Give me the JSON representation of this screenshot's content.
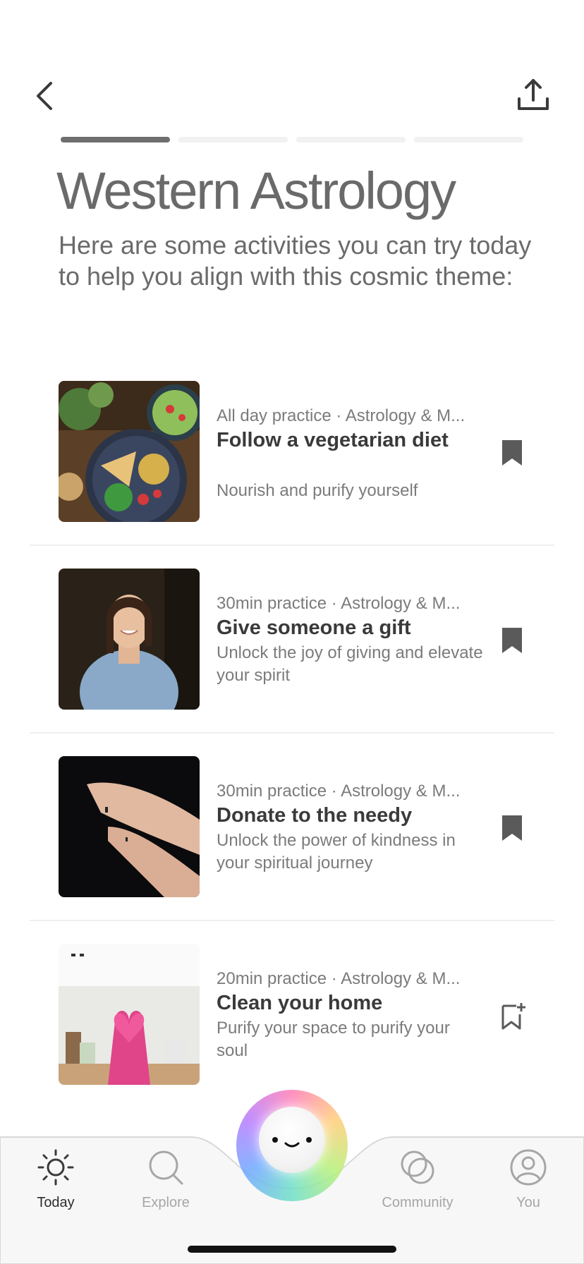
{
  "header": {
    "back_icon": "chevron-left-icon",
    "share_icon": "share-upload-icon",
    "progress": {
      "segments": 4,
      "active_index": 0
    }
  },
  "page": {
    "title": "Western Astrology",
    "intro": "Here are some activities you can try today to help you align with this cosmic theme:"
  },
  "activities": [
    {
      "meta": "All day practice · Astrology & M...",
      "name": "Follow a vegetarian diet",
      "description": "Nourish and purify yourself",
      "bookmarked": true,
      "image": "vegetarian-food-bowls"
    },
    {
      "meta": "30min practice · Astrology & M...",
      "name": "Give someone a gift",
      "description": "Unlock the joy of giving and elevate your spirit",
      "bookmarked": true,
      "image": "smiling-woman"
    },
    {
      "meta": "30min practice · Astrology & M...",
      "name": "Donate to the needy",
      "description": "Unlock the power of kindness in your spiritual journey",
      "bookmarked": true,
      "image": "hands-giving"
    },
    {
      "meta": "20min practice · Astrology & M...",
      "name": "Clean your home",
      "description": "Purify your space to purify your soul",
      "bookmarked": false,
      "image": "pink-gloves-heart-kitchen"
    }
  ],
  "tabbar": {
    "tabs": [
      {
        "label": "Today",
        "icon": "sun-icon",
        "active": true
      },
      {
        "label": "Explore",
        "icon": "search-icon",
        "active": false
      },
      {
        "label": "Community",
        "icon": "community-icon",
        "active": false
      },
      {
        "label": "You",
        "icon": "profile-icon",
        "active": false
      }
    ],
    "center_button_icon": "smiley-orb-icon"
  },
  "colors": {
    "text_dark": "#3a3a3a",
    "text_muted": "#7b7b7b",
    "progress_active": "#6e6e6e",
    "progress_inactive": "#f1f1f1"
  }
}
